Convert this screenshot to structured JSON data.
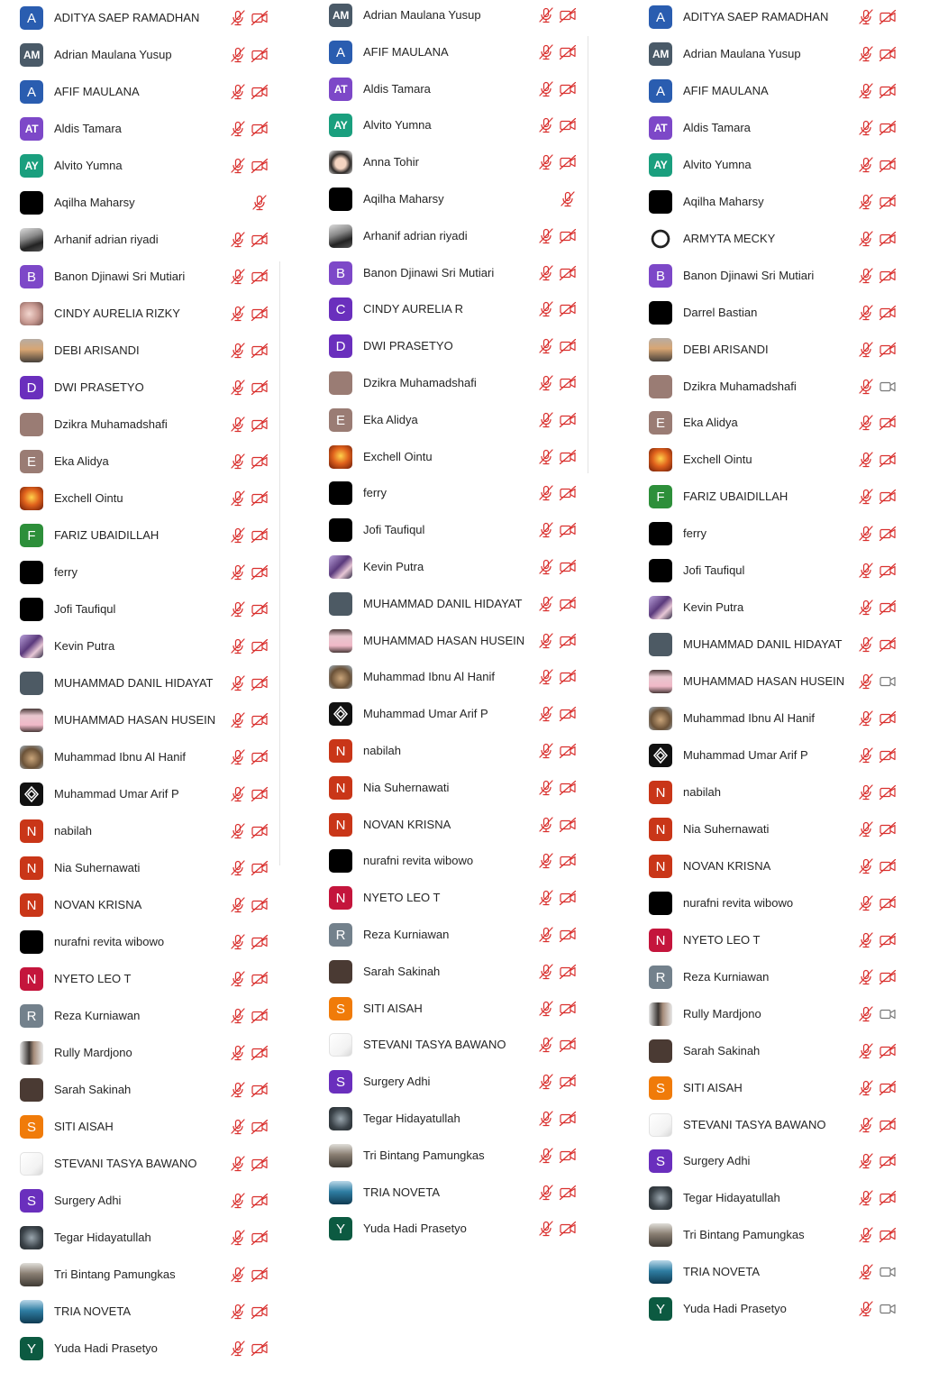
{
  "colors": {
    "blue": "#2a5db0",
    "gray": "#4a5a68",
    "purple": "#7d48c8",
    "teal": "#1a9f7e",
    "black": "#000000",
    "brown": "#9a7c74",
    "darkpurple": "#6a2fbd",
    "green": "#2d8f3a",
    "red": "#c93618",
    "crimson": "#c4153c",
    "slate": "#73818c",
    "orange": "#f07b09",
    "darkgreen": "#0c5a41",
    "muted_red": "#d9302e",
    "video_gray": "#777777"
  },
  "columns": [
    {
      "name": "participants-list-1",
      "rows": [
        {
          "name": "ADITYA SAEP RAMADHAN",
          "initials": "A",
          "avatar": "blue",
          "mic": "muted",
          "video": "off"
        },
        {
          "name": "Adrian Maulana Yusup",
          "initials": "AM",
          "avatar": "gray",
          "mic": "muted",
          "video": "off"
        },
        {
          "name": "AFIF MAULANA",
          "initials": "A",
          "avatar": "blue",
          "mic": "muted",
          "video": "off"
        },
        {
          "name": "Aldis Tamara",
          "initials": "AT",
          "avatar": "purple",
          "mic": "muted",
          "video": "off"
        },
        {
          "name": "Alvito Yumna",
          "initials": "AY",
          "avatar": "teal",
          "mic": "muted",
          "video": "off"
        },
        {
          "name": "Aqilha Maharsy",
          "initials": "",
          "avatar": "black",
          "mic": "muted",
          "video": "none"
        },
        {
          "name": "Arhanif adrian riyadi",
          "initials": "",
          "avatar": "photo-car",
          "mic": "muted",
          "video": "off"
        },
        {
          "name": "Banon Djinawi Sri Mutiari",
          "initials": "B",
          "avatar": "purple",
          "mic": "muted",
          "video": "off"
        },
        {
          "name": "CINDY AURELIA RIZKY",
          "initials": "",
          "avatar": "photo-pink",
          "mic": "muted",
          "video": "off"
        },
        {
          "name": "DEBI ARISANDI",
          "initials": "",
          "avatar": "photo-sunset",
          "mic": "muted",
          "video": "off"
        },
        {
          "name": "DWI PRASETYO",
          "initials": "D",
          "avatar": "darkpurple",
          "mic": "muted",
          "video": "off"
        },
        {
          "name": "Dzikra Muhamadshafi",
          "initials": "",
          "avatar": "brown",
          "mic": "muted",
          "video": "off"
        },
        {
          "name": "Eka Alidya",
          "initials": "E",
          "avatar": "brown",
          "mic": "muted",
          "video": "off"
        },
        {
          "name": "Exchell Ointu",
          "initials": "",
          "avatar": "photo-fire",
          "mic": "muted",
          "video": "off"
        },
        {
          "name": "FARIZ UBAIDILLAH",
          "initials": "F",
          "avatar": "green",
          "mic": "muted",
          "video": "off"
        },
        {
          "name": "ferry",
          "initials": "",
          "avatar": "black",
          "mic": "muted",
          "video": "off"
        },
        {
          "name": "Jofi Taufiqul",
          "initials": "",
          "avatar": "black",
          "mic": "muted",
          "video": "off"
        },
        {
          "name": "Kevin Putra",
          "initials": "",
          "avatar": "photo-anime",
          "mic": "muted",
          "video": "off"
        },
        {
          "name": "MUHAMMAD DANIL HIDAYAT",
          "initials": "",
          "avatar": "photo-slate",
          "mic": "muted",
          "video": "off"
        },
        {
          "name": "MUHAMMAD HASAN HUSEIN",
          "initials": "",
          "avatar": "photo-card",
          "mic": "muted",
          "video": "off"
        },
        {
          "name": "Muhammad Ibnu Al Hanif",
          "initials": "",
          "avatar": "photo-face",
          "mic": "muted",
          "video": "off"
        },
        {
          "name": "Muhammad Umar Arif P",
          "initials": "",
          "avatar": "photo-logo",
          "mic": "muted",
          "video": "off"
        },
        {
          "name": "nabilah",
          "initials": "N",
          "avatar": "red",
          "mic": "muted",
          "video": "off"
        },
        {
          "name": "Nia Suhernawati",
          "initials": "N",
          "avatar": "red",
          "mic": "muted",
          "video": "off"
        },
        {
          "name": "NOVAN KRISNA",
          "initials": "N",
          "avatar": "red",
          "mic": "muted",
          "video": "off"
        },
        {
          "name": "nurafni revita wibowo",
          "initials": "",
          "avatar": "black",
          "mic": "muted",
          "video": "off"
        },
        {
          "name": "NYETO LEO T",
          "initials": "N",
          "avatar": "crimson",
          "mic": "muted",
          "video": "off"
        },
        {
          "name": "Reza Kurniawan",
          "initials": "R",
          "avatar": "slate",
          "mic": "muted",
          "video": "off"
        },
        {
          "name": "Rully Mardjono",
          "initials": "",
          "avatar": "photo-person",
          "mic": "muted",
          "video": "off"
        },
        {
          "name": "Sarah Sakinah",
          "initials": "",
          "avatar": "photo-dark",
          "mic": "muted",
          "video": "off"
        },
        {
          "name": "SITI AISAH",
          "initials": "S",
          "avatar": "orange",
          "mic": "muted",
          "video": "off"
        },
        {
          "name": "STEVANI TASYA BAWANO",
          "initials": "",
          "avatar": "photo-white",
          "mic": "muted",
          "video": "off"
        },
        {
          "name": "Surgery Adhi",
          "initials": "S",
          "avatar": "darkpurple",
          "mic": "muted",
          "video": "off"
        },
        {
          "name": "Tegar Hidayatullah",
          "initials": "",
          "avatar": "photo-elephant",
          "mic": "muted",
          "video": "off"
        },
        {
          "name": "Tri Bintang Pamungkas",
          "initials": "",
          "avatar": "photo-road",
          "mic": "muted",
          "video": "off"
        },
        {
          "name": "TRIA NOVETA",
          "initials": "",
          "avatar": "photo-sea",
          "mic": "muted",
          "video": "off"
        },
        {
          "name": "Yuda Hadi Prasetyo",
          "initials": "Y",
          "avatar": "darkgreen",
          "mic": "muted",
          "video": "off"
        }
      ]
    },
    {
      "name": "participants-list-2",
      "rows": [
        {
          "name": "Adrian Maulana Yusup",
          "initials": "AM",
          "avatar": "gray",
          "mic": "muted",
          "video": "off"
        },
        {
          "name": "AFIF MAULANA",
          "initials": "A",
          "avatar": "blue",
          "mic": "muted",
          "video": "off"
        },
        {
          "name": "Aldis Tamara",
          "initials": "AT",
          "avatar": "purple",
          "mic": "muted",
          "video": "off"
        },
        {
          "name": "Alvito Yumna",
          "initials": "AY",
          "avatar": "teal",
          "mic": "muted",
          "video": "off"
        },
        {
          "name": "Anna Tohir",
          "initials": "",
          "avatar": "photo-woman",
          "mic": "muted",
          "video": "off"
        },
        {
          "name": "Aqilha Maharsy",
          "initials": "",
          "avatar": "black",
          "mic": "none",
          "video": "muted-only"
        },
        {
          "name": "Arhanif adrian riyadi",
          "initials": "",
          "avatar": "photo-car",
          "mic": "muted",
          "video": "off"
        },
        {
          "name": "Banon Djinawi Sri Mutiari",
          "initials": "B",
          "avatar": "purple",
          "mic": "muted",
          "video": "off"
        },
        {
          "name": "CINDY AURELIA R",
          "initials": "C",
          "avatar": "darkpurple",
          "mic": "muted",
          "video": "off"
        },
        {
          "name": "DWI PRASETYO",
          "initials": "D",
          "avatar": "darkpurple",
          "mic": "muted",
          "video": "off"
        },
        {
          "name": "Dzikra Muhamadshafi",
          "initials": "",
          "avatar": "brown",
          "mic": "muted",
          "video": "off"
        },
        {
          "name": "Eka Alidya",
          "initials": "E",
          "avatar": "brown",
          "mic": "muted",
          "video": "off"
        },
        {
          "name": "Exchell Ointu",
          "initials": "",
          "avatar": "photo-fire",
          "mic": "muted",
          "video": "off"
        },
        {
          "name": "ferry",
          "initials": "",
          "avatar": "black",
          "mic": "muted",
          "video": "off"
        },
        {
          "name": "Jofi Taufiqul",
          "initials": "",
          "avatar": "black",
          "mic": "muted",
          "video": "off"
        },
        {
          "name": "Kevin Putra",
          "initials": "",
          "avatar": "photo-anime",
          "mic": "muted",
          "video": "off"
        },
        {
          "name": "MUHAMMAD DANIL HIDAYAT",
          "initials": "",
          "avatar": "photo-slate",
          "mic": "muted",
          "video": "off"
        },
        {
          "name": "MUHAMMAD HASAN HUSEIN",
          "initials": "",
          "avatar": "photo-card",
          "mic": "muted",
          "video": "off"
        },
        {
          "name": "Muhammad Ibnu Al Hanif",
          "initials": "",
          "avatar": "photo-face",
          "mic": "muted",
          "video": "off"
        },
        {
          "name": "Muhammad Umar Arif P",
          "initials": "",
          "avatar": "photo-logo",
          "mic": "muted",
          "video": "off"
        },
        {
          "name": "nabilah",
          "initials": "N",
          "avatar": "red",
          "mic": "muted",
          "video": "off"
        },
        {
          "name": "Nia Suhernawati",
          "initials": "N",
          "avatar": "red",
          "mic": "muted",
          "video": "off"
        },
        {
          "name": "NOVAN KRISNA",
          "initials": "N",
          "avatar": "red",
          "mic": "muted",
          "video": "off"
        },
        {
          "name": "nurafni revita wibowo",
          "initials": "",
          "avatar": "black",
          "mic": "muted",
          "video": "off"
        },
        {
          "name": "NYETO LEO T",
          "initials": "N",
          "avatar": "crimson",
          "mic": "muted",
          "video": "off"
        },
        {
          "name": "Reza Kurniawan",
          "initials": "R",
          "avatar": "slate",
          "mic": "muted",
          "video": "off"
        },
        {
          "name": "Sarah Sakinah",
          "initials": "",
          "avatar": "photo-dark",
          "mic": "muted",
          "video": "off"
        },
        {
          "name": "SITI AISAH",
          "initials": "S",
          "avatar": "orange",
          "mic": "muted",
          "video": "off"
        },
        {
          "name": "STEVANI TASYA BAWANO",
          "initials": "",
          "avatar": "photo-white",
          "mic": "muted",
          "video": "off"
        },
        {
          "name": "Surgery Adhi",
          "initials": "S",
          "avatar": "darkpurple",
          "mic": "muted",
          "video": "off"
        },
        {
          "name": "Tegar Hidayatullah",
          "initials": "",
          "avatar": "photo-elephant",
          "mic": "muted",
          "video": "off"
        },
        {
          "name": "Tri Bintang Pamungkas",
          "initials": "",
          "avatar": "photo-road",
          "mic": "muted",
          "video": "off"
        },
        {
          "name": "TRIA NOVETA",
          "initials": "",
          "avatar": "photo-sea",
          "mic": "muted",
          "video": "off"
        },
        {
          "name": "Yuda Hadi Prasetyo",
          "initials": "Y",
          "avatar": "darkgreen",
          "mic": "muted",
          "video": "off"
        }
      ]
    },
    {
      "name": "participants-list-3",
      "rows": [
        {
          "name": "ADITYA SAEP RAMADHAN",
          "initials": "A",
          "avatar": "blue",
          "mic": "muted",
          "video": "off"
        },
        {
          "name": "Adrian Maulana Yusup",
          "initials": "AM",
          "avatar": "gray",
          "mic": "muted",
          "video": "off"
        },
        {
          "name": "AFIF MAULANA",
          "initials": "A",
          "avatar": "blue",
          "mic": "muted",
          "video": "off"
        },
        {
          "name": "Aldis Tamara",
          "initials": "AT",
          "avatar": "purple",
          "mic": "muted",
          "video": "off"
        },
        {
          "name": "Alvito Yumna",
          "initials": "AY",
          "avatar": "teal",
          "mic": "muted",
          "video": "off"
        },
        {
          "name": "Aqilha Maharsy",
          "initials": "",
          "avatar": "black",
          "mic": "muted",
          "video": "off"
        },
        {
          "name": "ARMYTA MECKY",
          "initials": "",
          "avatar": "photo-avengers",
          "mic": "muted",
          "video": "off"
        },
        {
          "name": "Banon Djinawi Sri Mutiari",
          "initials": "B",
          "avatar": "purple",
          "mic": "muted",
          "video": "off"
        },
        {
          "name": "Darrel Bastian",
          "initials": "",
          "avatar": "black",
          "mic": "muted",
          "video": "off"
        },
        {
          "name": "DEBI ARISANDI",
          "initials": "",
          "avatar": "photo-sunset",
          "mic": "muted",
          "video": "off"
        },
        {
          "name": "Dzikra Muhamadshafi",
          "initials": "",
          "avatar": "brown",
          "mic": "muted",
          "video": "on"
        },
        {
          "name": "Eka Alidya",
          "initials": "E",
          "avatar": "brown",
          "mic": "muted",
          "video": "off"
        },
        {
          "name": "Exchell Ointu",
          "initials": "",
          "avatar": "photo-fire",
          "mic": "muted",
          "video": "off"
        },
        {
          "name": "FARIZ UBAIDILLAH",
          "initials": "F",
          "avatar": "green",
          "mic": "muted",
          "video": "off"
        },
        {
          "name": "ferry",
          "initials": "",
          "avatar": "black",
          "mic": "muted",
          "video": "off"
        },
        {
          "name": "Jofi Taufiqul",
          "initials": "",
          "avatar": "black",
          "mic": "muted",
          "video": "off"
        },
        {
          "name": "Kevin Putra",
          "initials": "",
          "avatar": "photo-anime",
          "mic": "muted",
          "video": "off"
        },
        {
          "name": "MUHAMMAD DANIL HIDAYAT",
          "initials": "",
          "avatar": "photo-slate",
          "mic": "muted",
          "video": "off"
        },
        {
          "name": "MUHAMMAD HASAN HUSEIN",
          "initials": "",
          "avatar": "photo-card",
          "mic": "muted",
          "video": "on"
        },
        {
          "name": "Muhammad Ibnu Al Hanif",
          "initials": "",
          "avatar": "photo-face",
          "mic": "muted",
          "video": "off"
        },
        {
          "name": "Muhammad Umar Arif P",
          "initials": "",
          "avatar": "photo-logo",
          "mic": "muted",
          "video": "off"
        },
        {
          "name": "nabilah",
          "initials": "N",
          "avatar": "red",
          "mic": "muted",
          "video": "off"
        },
        {
          "name": "Nia Suhernawati",
          "initials": "N",
          "avatar": "red",
          "mic": "muted",
          "video": "off"
        },
        {
          "name": "NOVAN KRISNA",
          "initials": "N",
          "avatar": "red",
          "mic": "muted",
          "video": "off"
        },
        {
          "name": "nurafni revita wibowo",
          "initials": "",
          "avatar": "black",
          "mic": "muted",
          "video": "off"
        },
        {
          "name": "NYETO LEO T",
          "initials": "N",
          "avatar": "crimson",
          "mic": "muted",
          "video": "off"
        },
        {
          "name": "Reza Kurniawan",
          "initials": "R",
          "avatar": "slate",
          "mic": "muted",
          "video": "off"
        },
        {
          "name": "Rully Mardjono",
          "initials": "",
          "avatar": "photo-person",
          "mic": "muted",
          "video": "on"
        },
        {
          "name": "Sarah Sakinah",
          "initials": "",
          "avatar": "photo-dark",
          "mic": "muted",
          "video": "off"
        },
        {
          "name": "SITI AISAH",
          "initials": "S",
          "avatar": "orange",
          "mic": "muted",
          "video": "off"
        },
        {
          "name": "STEVANI TASYA BAWANO",
          "initials": "",
          "avatar": "photo-white",
          "mic": "muted",
          "video": "off"
        },
        {
          "name": "Surgery Adhi",
          "initials": "S",
          "avatar": "darkpurple",
          "mic": "muted",
          "video": "off"
        },
        {
          "name": "Tegar Hidayatullah",
          "initials": "",
          "avatar": "photo-elephant",
          "mic": "muted",
          "video": "off"
        },
        {
          "name": "Tri Bintang Pamungkas",
          "initials": "",
          "avatar": "photo-road",
          "mic": "muted",
          "video": "off"
        },
        {
          "name": "TRIA NOVETA",
          "initials": "",
          "avatar": "photo-sea",
          "mic": "muted",
          "video": "on"
        },
        {
          "name": "Yuda Hadi Prasetyo",
          "initials": "Y",
          "avatar": "darkgreen",
          "mic": "muted",
          "video": "on"
        }
      ]
    }
  ]
}
